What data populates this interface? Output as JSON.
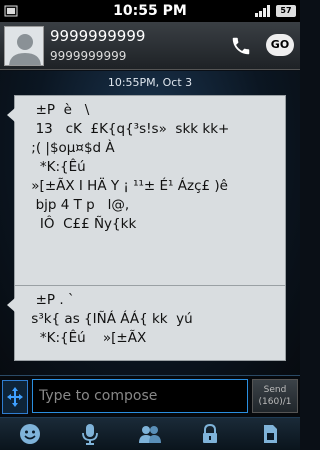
{
  "status_bar": {
    "time": "10:55 PM",
    "battery": "57"
  },
  "header": {
    "contact_name": "9999999999",
    "contact_number": "9999999999",
    "go_label": "GO"
  },
  "conversation": {
    "timestamp": "10:55PM, Oct 3",
    "messages": [
      {
        "text": "  ±P  è   \\\n  13   cK  £K{q{³s!s»  skk kk+\n ;( |$oµ¤$d À\n   *K:{Êú\n »[±ÃX I HÄ Y ¡ ¹¹± É¹ Ázç£ )ê\n  bjp 4 T p   l@,\n   IÔ  C££ Ñy{kk"
      },
      {
        "text": "  ±P . `\n s³k{ as {IÑÁ ÁÁ{ kk  yú\n   *K:{Êú    »[±ÃX"
      }
    ]
  },
  "compose": {
    "placeholder": "Type to compose",
    "send_label": "Send",
    "send_count": "(160)/1"
  },
  "colors": {
    "accent": "#2a8fe0",
    "bubble": "#d9dde0"
  },
  "toolbar_icons": [
    "smiley-icon",
    "microphone-icon",
    "group-icon",
    "lock-icon",
    "sim-card-icon"
  ]
}
